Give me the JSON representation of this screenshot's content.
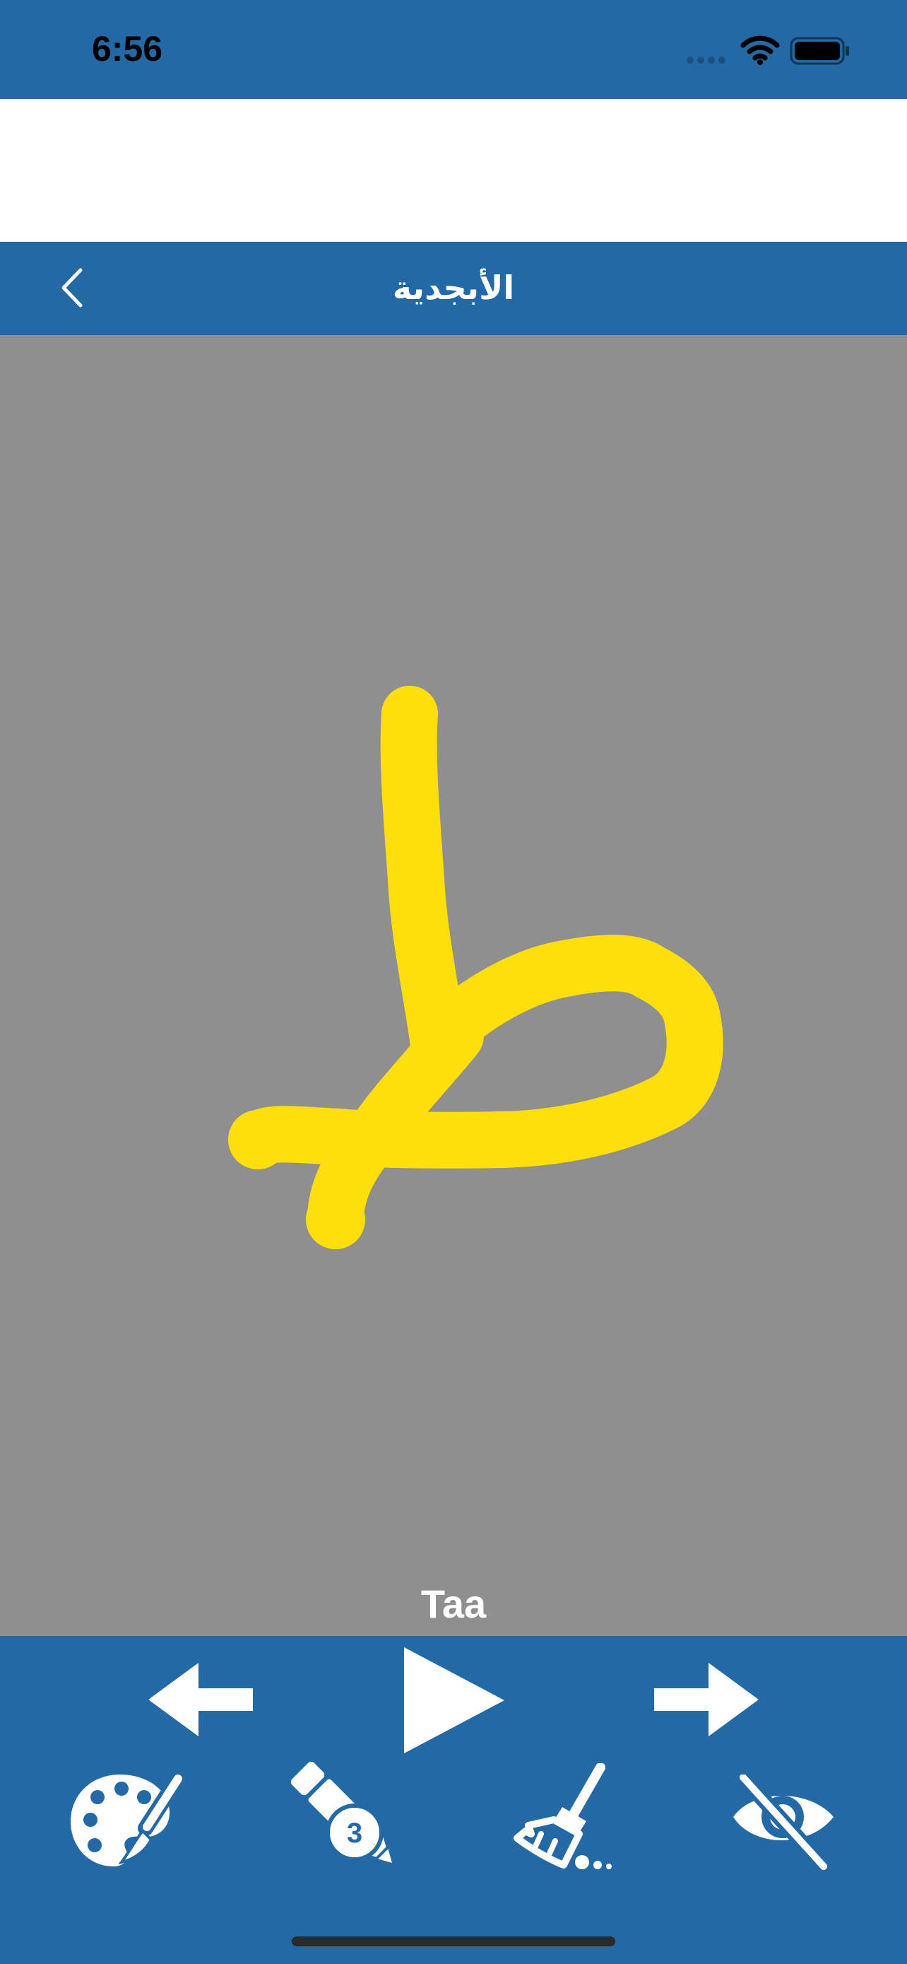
{
  "status_bar": {
    "time": "6:56",
    "icons": [
      "cellular-signal-icon",
      "wifi-icon",
      "battery-icon"
    ]
  },
  "nav": {
    "back_icon": "chevron-left-icon",
    "title": "الأبجدية"
  },
  "canvas": {
    "background_color": "#8f8f8f",
    "stroke_color": "#ffdf0b",
    "letter_name": "Taa"
  },
  "toolbar": {
    "background_color": "#2369a5",
    "row1": [
      "arrow-left-icon",
      "play-icon",
      "arrow-right-icon"
    ],
    "row2": [
      "palette-icon",
      "marker-icon",
      "broom-icon",
      "eye-slash-icon"
    ],
    "marker_size": "3"
  }
}
